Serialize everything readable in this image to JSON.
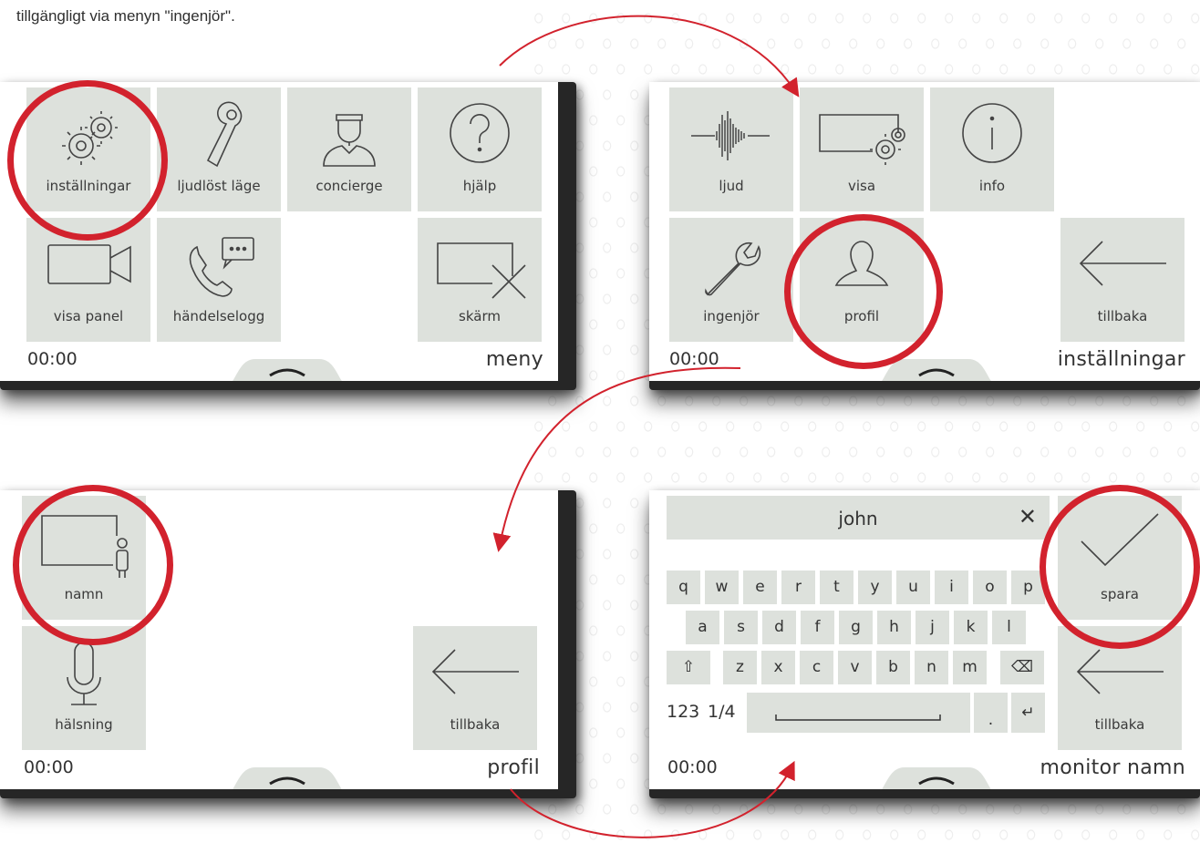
{
  "intro_text": "tillgängligt via menyn \"ingenjör\".",
  "colors": {
    "tile": "#dde1dc",
    "highlight": "#d2222d",
    "text": "#3a3a3a",
    "bezel": "#262626"
  },
  "screens": {
    "menu": {
      "title": "meny",
      "time": "00:00",
      "tiles": {
        "settings": "inställningar",
        "silent": "ljudlöst läge",
        "concierge": "concierge",
        "help": "hjälp",
        "show_panel": "visa panel",
        "event_log": "händelselogg",
        "screen": "skärm"
      },
      "icons": {
        "settings": "gears-icon",
        "silent": "door-hanger-icon",
        "concierge": "concierge-icon",
        "help": "question-icon",
        "show_panel": "camera-icon",
        "event_log": "phone-chat-icon",
        "screen": "screen-off-icon"
      }
    },
    "settings": {
      "title": "inställningar",
      "time": "00:00",
      "tiles": {
        "sound": "ljud",
        "display": "visa",
        "info": "info",
        "engineer": "ingenjör",
        "profile": "profil",
        "back": "tillbaka"
      },
      "icons": {
        "sound": "waveform-icon",
        "display": "display-gear-icon",
        "info": "info-icon",
        "engineer": "wrench-icon",
        "profile": "person-icon",
        "back": "arrow-left-icon"
      }
    },
    "profile": {
      "title": "profil",
      "time": "00:00",
      "tiles": {
        "name": "namn",
        "greeting": "hälsning",
        "back": "tillbaka"
      },
      "icons": {
        "name": "monitor-person-icon",
        "greeting": "microphone-icon",
        "back": "arrow-left-icon"
      }
    },
    "monitor_name": {
      "title": "monitor namn",
      "time": "00:00",
      "input_value": "john",
      "tiles": {
        "save": "spara",
        "back": "tillbaka"
      },
      "icons": {
        "save": "checkmark-icon",
        "back": "arrow-left-icon",
        "clear": "close-icon"
      },
      "keyboard": {
        "row1": [
          "q",
          "w",
          "e",
          "r",
          "t",
          "y",
          "u",
          "i",
          "o",
          "p"
        ],
        "row2": [
          "a",
          "s",
          "d",
          "f",
          "g",
          "h",
          "j",
          "k",
          "l"
        ],
        "row3": [
          "z",
          "x",
          "c",
          "v",
          "b",
          "n",
          "m"
        ],
        "numbers_key": "123",
        "page_key": "1/4",
        "period_key": "."
      }
    }
  }
}
